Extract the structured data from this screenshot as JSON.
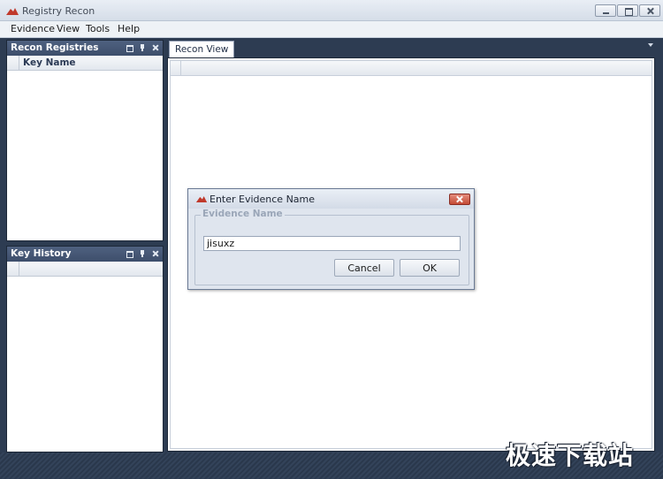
{
  "window": {
    "title": "Registry Recon"
  },
  "menu": [
    "Evidence",
    "View",
    "Tools",
    "Help"
  ],
  "panels": {
    "recon_registries": {
      "title": "Recon Registries",
      "column": "Key Name"
    },
    "key_history": {
      "title": "Key History"
    }
  },
  "tabs": [
    {
      "label": "Recon View"
    }
  ],
  "dialog": {
    "title": "Enter Evidence Name",
    "group_label": "Evidence Name",
    "input_value": "jisuxz",
    "cancel_label": "Cancel",
    "ok_label": "OK"
  },
  "watermark": "极速下载站",
  "colors": {
    "workspace": "#2d3c52",
    "panel_header": "#4f6180",
    "accent_red": "#c0392b"
  }
}
